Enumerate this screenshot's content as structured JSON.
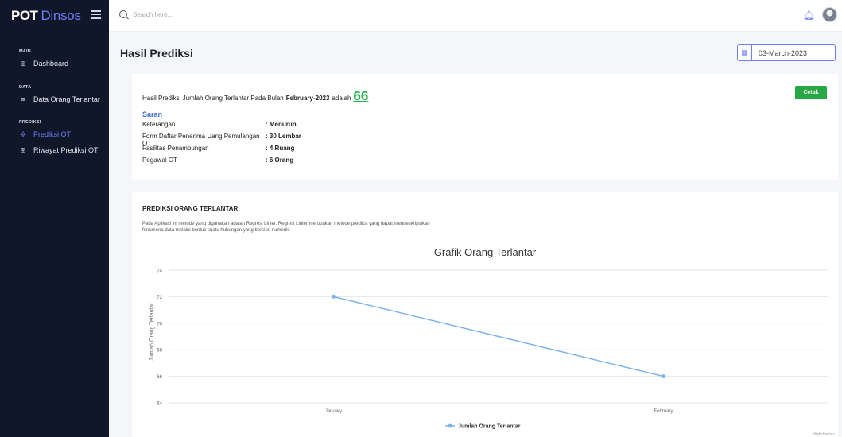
{
  "sidebar": {
    "brand_strong": "POT",
    "brand_light": "Dinsos",
    "sections": [
      {
        "title": "MAIN",
        "items": [
          {
            "label": "Dashboard",
            "icon": "dashboard-icon",
            "active": false
          }
        ]
      },
      {
        "title": "DATA",
        "items": [
          {
            "label": "Data Orang Terlantar",
            "icon": "list-icon",
            "active": false
          }
        ]
      },
      {
        "title": "PREDIKSI",
        "items": [
          {
            "label": "Prediksi OT",
            "icon": "gear-icon",
            "active": true
          },
          {
            "label": "Riwayat Prediksi OT",
            "icon": "book-icon",
            "active": false
          }
        ]
      }
    ]
  },
  "topbar": {
    "search_placeholder": "Search here..."
  },
  "page": {
    "title": "Hasil Prediksi",
    "date_value": "03-March-2023"
  },
  "result": {
    "prefix": "Hasil Prediksi Jumlah Orang Terlantar Pada Bulan",
    "month": "February-2023",
    "middle": "adalah",
    "value": "66",
    "print_label": "Cetak"
  },
  "saran": {
    "title": "Saran",
    "rows": [
      {
        "key": "Keterangan",
        "value": ": Menurun"
      },
      {
        "key": "Form Daftar Penerima Uang Pemulangan OT",
        "value": ": 30 Lembar"
      },
      {
        "key": "Fasilitas Penampungan",
        "value": ": 4 Ruang"
      },
      {
        "key": "Pegawai OT",
        "value": ": 6 Orang"
      }
    ]
  },
  "prediction_card": {
    "title": "PREDIKSI ORANG TERLANTAR",
    "desc_line1": "Pada Aplikasi ini metode yang digunakan adalah Regresi Linier. Regresi Linier merupakan metode prediksi yang dapat mendeskripsikan",
    "desc_line2": "fenomena data melalui bentuk suatu hubungan yang bersifat numerik."
  },
  "chart_data": {
    "type": "line",
    "title": "Grafik Orang Terlantar",
    "ylabel": "Jumlah Orang Terlantar",
    "xlabel": "",
    "categories": [
      "January",
      "February"
    ],
    "series": [
      {
        "name": "Jumlah Orang Terlantar",
        "values": [
          72,
          66
        ],
        "color": "#7cb5ec"
      }
    ],
    "ylim": [
      64,
      74
    ],
    "yticks": [
      64,
      66,
      68,
      70,
      72,
      74
    ],
    "grid": true,
    "legend": "bottom-center",
    "credit": "Highcharts.c"
  }
}
